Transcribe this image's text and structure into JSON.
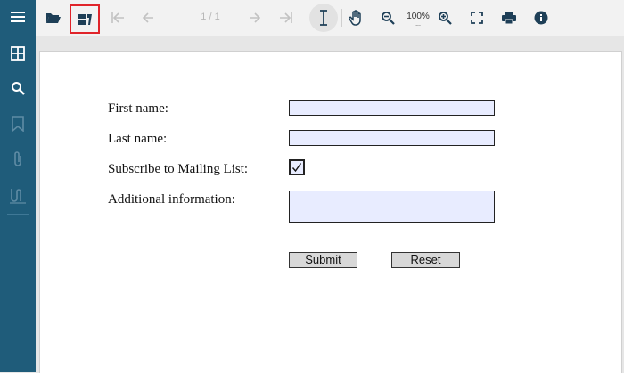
{
  "toolbar": {
    "open_icon": "folder-open-icon",
    "form_icon": "form-fields-icon",
    "page_indicator": "1 / 1",
    "zoom_level": "100%",
    "zoom_more": "...",
    "highlight_color": "#e0242a"
  },
  "sidebar": {
    "items": [
      "menu-icon",
      "thumbnails-icon",
      "search-icon",
      "bookmark-icon",
      "attachment-icon",
      "signature-icon"
    ]
  },
  "form": {
    "first_name_label": "First name:",
    "first_name_value": "",
    "last_name_label": "Last name:",
    "last_name_value": "",
    "subscribe_label": "Subscribe to Mailing List:",
    "subscribe_checked": true,
    "additional_label": "Additional information:",
    "additional_value": "",
    "submit_label": "Submit",
    "reset_label": "Reset"
  },
  "colors": {
    "sidebar_bg": "#1f5c7a",
    "field_bg": "#e8ecff"
  }
}
